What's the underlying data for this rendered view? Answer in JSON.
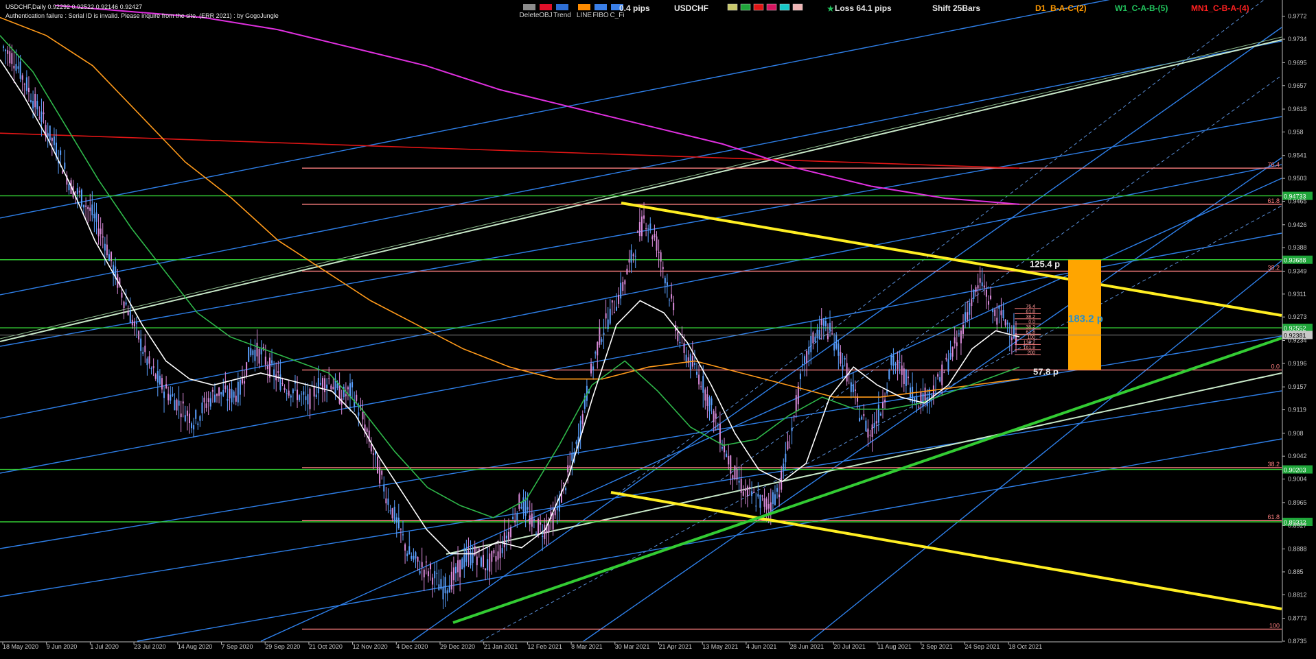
{
  "header": {
    "symbol_line": "USDCHF,Daily  0.92292 0.92522 0.92146 0.92427",
    "auth_notice": "Authentication failure : Serial ID is invalid. Please inquire from the site. (ERR 2021) : by GogoJungle",
    "toolbar": [
      {
        "label": "Delete",
        "color": "#8c8c8c"
      },
      {
        "label": "OBJ",
        "color": "#e0102a"
      },
      {
        "label": "Trend",
        "color": "#2e6fd6"
      },
      {
        "label": "LINE",
        "color": "#ff8c00"
      },
      {
        "label": "FIBO",
        "color": "#3a7fe8"
      },
      {
        "label": "C_Fi",
        "color": "#3a7fe8"
      }
    ],
    "spread": "0.4 pips",
    "symbol": "USDCHF",
    "swatch_colors": [
      "#c8c86a",
      "#1fa63a",
      "#e01515",
      "#d61560",
      "#17c8c8",
      "#f0b4b4"
    ],
    "loss": "Loss 64.1 pips",
    "shift": "Shift 25Bars",
    "d1": "D1_B-A-C-(2)",
    "w1": "W1_C-A-B-(5)",
    "mn1": "MN1_C-B-A-(4)",
    "d1_color": "#ff9900",
    "w1_color": "#22c55e",
    "mn1_color": "#ff2020"
  },
  "annotations": {
    "pips_up": "125.4 p",
    "pips_box": "183.2 p",
    "pips_down": "57.8 p"
  },
  "fib_levels_right": [
    "76.4",
    "61.8",
    "38.2",
    "0.0",
    "38.2",
    "61.8",
    "100"
  ],
  "fib_levels_mini": [
    "76.4",
    "61.8",
    "38.2",
    "0.0",
    "38.2",
    "61.8",
    "100",
    "138.2",
    "161.8",
    "200"
  ],
  "chart_data": {
    "type": "candlestick",
    "title": "USDCHF,Daily",
    "y_ticks": [
      0.9772,
      0.9734,
      0.9695,
      0.9657,
      0.9618,
      0.958,
      0.9541,
      0.9503,
      0.9465,
      0.9426,
      0.9388,
      0.9349,
      0.9311,
      0.9273,
      0.9234,
      0.9196,
      0.9157,
      0.9119,
      0.908,
      0.9042,
      0.9004,
      0.8965,
      0.8927,
      0.8888,
      0.885,
      0.8812,
      0.8773,
      0.8735
    ],
    "ylim": [
      0.8735,
      0.9799
    ],
    "x_ticks": [
      "18 May 2020",
      "9 Jun 2020",
      "1 Jul 2020",
      "23 Jul 2020",
      "14 Aug 2020",
      "7 Sep 2020",
      "29 Sep 2020",
      "21 Oct 2020",
      "12 Nov 2020",
      "4 Dec 2020",
      "29 Dec 2020",
      "21 Jan 2021",
      "12 Feb 2021",
      "8 Mar 2021",
      "30 Mar 2021",
      "21 Apr 2021",
      "13 May 2021",
      "4 Jun 2021",
      "28 Jun 2021",
      "20 Jul 2021",
      "11 Aug 2021",
      "2 Sep 2021",
      "24 Sep 2021",
      "18 Oct 2021"
    ],
    "price_path": [
      0.972,
      0.97,
      0.966,
      0.962,
      0.958,
      0.954,
      0.949,
      0.947,
      0.944,
      0.94,
      0.934,
      0.929,
      0.924,
      0.919,
      0.916,
      0.914,
      0.912,
      0.91,
      0.913,
      0.915,
      0.914,
      0.915,
      0.922,
      0.921,
      0.918,
      0.916,
      0.915,
      0.913,
      0.916,
      0.917,
      0.914,
      0.915,
      0.91,
      0.904,
      0.898,
      0.893,
      0.888,
      0.886,
      0.885,
      0.882,
      0.884,
      0.887,
      0.888,
      0.886,
      0.888,
      0.892,
      0.897,
      0.893,
      0.892,
      0.894,
      0.9,
      0.906,
      0.916,
      0.924,
      0.928,
      0.932,
      0.938,
      0.944,
      0.94,
      0.933,
      0.924,
      0.92,
      0.917,
      0.912,
      0.906,
      0.901,
      0.898,
      0.897,
      0.896,
      0.899,
      0.908,
      0.918,
      0.924,
      0.926,
      0.923,
      0.918,
      0.912,
      0.908,
      0.912,
      0.92,
      0.918,
      0.914,
      0.914,
      0.916,
      0.92,
      0.924,
      0.93,
      0.933,
      0.928,
      0.927,
      0.924
    ],
    "price_colors": {
      "up": "#5aa0ff",
      "down": "#d98ad9"
    },
    "ma_white": [
      0.97,
      0.964,
      0.957,
      0.949,
      0.94,
      0.933,
      0.926,
      0.92,
      0.917,
      0.916,
      0.917,
      0.918,
      0.917,
      0.916,
      0.915,
      0.911,
      0.904,
      0.898,
      0.892,
      0.888,
      0.888,
      0.89,
      0.889,
      0.892,
      0.901,
      0.914,
      0.926,
      0.93,
      0.928,
      0.923,
      0.916,
      0.908,
      0.902,
      0.9,
      0.903,
      0.914,
      0.919,
      0.916,
      0.914,
      0.913,
      0.916,
      0.922,
      0.925,
      0.924
    ],
    "ma_green": [
      0.974,
      0.968,
      0.959,
      0.95,
      0.942,
      0.935,
      0.928,
      0.924,
      0.922,
      0.92,
      0.918,
      0.912,
      0.905,
      0.899,
      0.896,
      0.894,
      0.897,
      0.906,
      0.916,
      0.92,
      0.915,
      0.909,
      0.906,
      0.907,
      0.911,
      0.914,
      0.912,
      0.912,
      0.913,
      0.915,
      0.917,
      0.919
    ],
    "ma_orange": [
      0.977,
      0.974,
      0.969,
      0.961,
      0.953,
      0.947,
      0.94,
      0.935,
      0.93,
      0.926,
      0.922,
      0.919,
      0.917,
      0.917,
      0.919,
      0.92,
      0.918,
      0.916,
      0.914,
      0.914,
      0.915,
      0.916,
      0.917
    ],
    "ma_magenta": [
      0.979,
      0.978,
      0.977,
      0.975,
      0.972,
      0.969,
      0.965,
      0.962,
      0.959,
      0.956,
      0.952,
      0.949,
      0.947,
      0.946
    ],
    "horizontal_levels": [
      {
        "price": 0.952,
        "color": "#ff8080",
        "label": "76.4"
      },
      {
        "price": 0.946,
        "color": "#ff8080",
        "label": "61.8"
      },
      {
        "price": 0.9349,
        "color": "#ff8080",
        "label": "38.2"
      },
      {
        "price": 0.9185,
        "color": "#ff8080",
        "label": "0.0"
      },
      {
        "price": 0.9023,
        "color": "#ff8080",
        "label": "38.2"
      },
      {
        "price": 0.8935,
        "color": "#ff8080",
        "label": "61.8"
      },
      {
        "price": 0.8755,
        "color": "#ff8080",
        "label": "100"
      },
      {
        "price": 0.9474,
        "color": "#33cc33",
        "label": "0.94733"
      },
      {
        "price": 0.9368,
        "color": "#33cc33",
        "label": "0.93688"
      },
      {
        "price": 0.9255,
        "color": "#33cc33",
        "label": "0.92552"
      },
      {
        "price": 0.902,
        "color": "#33cc33",
        "label": "0.90203"
      },
      {
        "price": 0.8933,
        "color": "#33cc33",
        "label": "0.89332"
      }
    ],
    "price_tag": {
      "price": 0.9243,
      "label": "0.92381"
    }
  }
}
